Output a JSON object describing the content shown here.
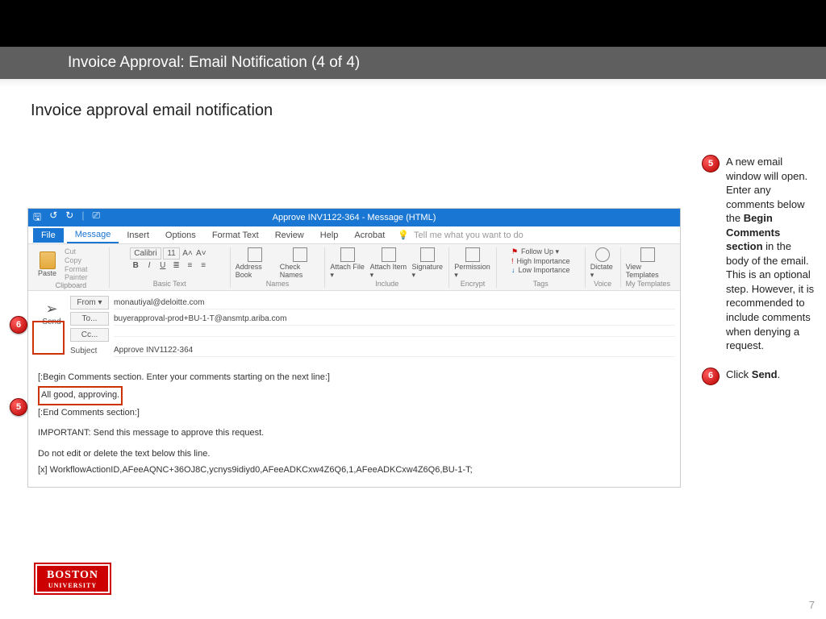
{
  "header": {
    "title": "Invoice Approval: Email Notification  (4 of 4)"
  },
  "subtitle": "Invoice approval email notification",
  "outlook": {
    "window_title": "Approve INV1122-364  -  Message (HTML)",
    "tabs": {
      "file": "File",
      "message": "Message",
      "insert": "Insert",
      "options": "Options",
      "format": "Format Text",
      "review": "Review",
      "help": "Help",
      "acrobat": "Acrobat",
      "tellme": "Tell me what you want to do"
    },
    "ribbon": {
      "paste": "Paste",
      "cut": "Cut",
      "copy": "Copy",
      "painter": "Format Painter",
      "clipboard_label": "Clipboard",
      "font_name": "Calibri",
      "font_size": "11",
      "basic_text_label": "Basic Text",
      "address_book": "Address Book",
      "check_names": "Check Names",
      "names_label": "Names",
      "attach_file": "Attach File ▾",
      "attach_item": "Attach Item ▾",
      "signature": "Signature ▾",
      "include_label": "Include",
      "permission": "Permission ▾",
      "encrypt_label": "Encrypt",
      "follow_up": "Follow Up ▾",
      "high_imp": "High Importance",
      "low_imp": "Low Importance",
      "tags_label": "Tags",
      "dictate": "Dictate ▾",
      "voice_label": "Voice",
      "view_tpl": "View Templates",
      "tpl_label": "My Templates"
    },
    "send": "Send",
    "fields": {
      "from_label": "From ▾",
      "from_value": "monautiyal@deloitte.com",
      "to_label": "To...",
      "to_value": "buyerapproval-prod+BU-1-T@ansmtp.ariba.com",
      "cc_label": "Cc...",
      "cc_value": "",
      "subject_label": "Subject",
      "subject_value": "Approve INV1122-364"
    },
    "body": {
      "begin": "[:Begin Comments section. Enter your comments starting on the next line:]",
      "comment": "All good, approving.",
      "end": "[:End Comments section:]",
      "important": "IMPORTANT: Send this message to approve this request.",
      "donot": "Do not edit or delete the text below this line.",
      "workflow": "[x] WorkflowActionID,AFeeAQNC+36OJ8C,ycnys9idiyd0,AFeeADKCxw4Z6Q6,1,AFeeADKCxw4Z6Q6,BU-1-T;"
    }
  },
  "instructions": {
    "step5": {
      "num": "5",
      "text_a": "A new email window will open. Enter any comments below the ",
      "bold1": "Begin Comments section",
      "text_b": " in the body of the email. This is an optional step. However, it is recommended to include comments when denying a request."
    },
    "step6": {
      "num": "6",
      "text_a": "Click ",
      "bold1": "Send",
      "text_b": "."
    }
  },
  "logo": {
    "line1": "BOSTON",
    "line2": "UNIVERSITY"
  },
  "page_number": "7"
}
